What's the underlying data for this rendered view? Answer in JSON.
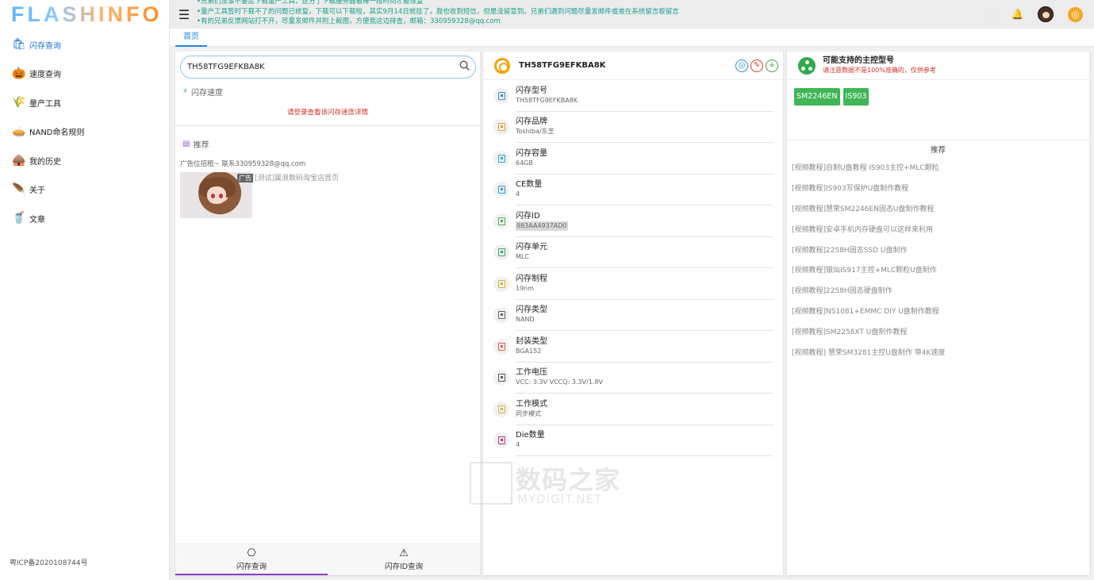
{
  "app": {
    "logo": "FLASHINFO",
    "icp": "粤ICP备2020108744号"
  },
  "header": {
    "notices": [
      "•兄弟们没事不要乱下载量产工具，这分了下载服务器着棒一段时间才能恢复",
      "•量产工具暂时下载不了的问题已修复，下载可以下载啦，其实9月14日就挂了，我也收到短信，但是没留意到。兄弟们遇到问题尽量发邮件或者在系统留言板留言",
      "•有的兄弟反馈网站打不开，尽量发邮件并附上截图，方便我这边排查，邮箱：330959328@qq.com"
    ]
  },
  "sidebar": {
    "items": [
      {
        "label": "闪存查询",
        "icon": "🛍",
        "active": true
      },
      {
        "label": "速度查询",
        "icon": "🎃"
      },
      {
        "label": "量产工具",
        "icon": "🌾"
      },
      {
        "label": "NAND命名规则",
        "icon": "🥧"
      },
      {
        "label": "我的历史",
        "icon": "🛖"
      },
      {
        "label": "关于",
        "icon": "🪶"
      },
      {
        "label": "文章",
        "icon": "🥤"
      }
    ]
  },
  "tabs": {
    "home": "首页"
  },
  "left": {
    "search_value": "TH58TFG9EFKBA8K",
    "speed_title": "闪存速度",
    "speed_msg": "请登录查看该闪存速度详情",
    "rec_title": "推荐",
    "ad_text": "广告位招租~ 联系330959328@qq.com",
    "ad_badge": "广告",
    "ad_label": "[测试]翼浪数码淘宝店首页",
    "bottom_tabs": [
      {
        "label": "闪存查询",
        "icon": "chip-icon"
      },
      {
        "label": "闪存ID查询",
        "icon": "warning-icon"
      }
    ]
  },
  "detail": {
    "title": "TH58TFG9EFKBA8K",
    "fields": [
      {
        "label": "闪存型号",
        "value": "TH58TFG9EFKBA8K",
        "color": "#3a8fd0"
      },
      {
        "label": "闪存品牌",
        "value": "Toshiba/东芝",
        "color": "#e2a23a"
      },
      {
        "label": "闪存容量",
        "value": "64GB",
        "color": "#2fa3c9"
      },
      {
        "label": "CE数量",
        "value": "4",
        "color": "#2f9ad6"
      },
      {
        "label": "闪存ID",
        "value": "983AA4937AD0",
        "color": "#4caf50"
      },
      {
        "label": "闪存单元",
        "value": "MLC",
        "color": "#3aa071"
      },
      {
        "label": "闪存制程",
        "value": "19nm",
        "color": "#c9b93a"
      },
      {
        "label": "闪存类型",
        "value": "NAND",
        "color": "#666666"
      },
      {
        "label": "封装类型",
        "value": "BGA152",
        "color": "#e0603a"
      },
      {
        "label": "工作电压",
        "value": "VCC: 3.3V VCCQ: 3.3V/1.8V",
        "color": "#555555"
      },
      {
        "label": "工作模式",
        "value": "同步模式",
        "color": "#e2b23a"
      },
      {
        "label": "Die数量",
        "value": "4",
        "color": "#c0357f"
      }
    ]
  },
  "controllers": {
    "title": "可能支持的主控型号",
    "subtitle": "请注意数据不是100%准确的，仅供参考",
    "tags": [
      "SM2246EN",
      "IS903"
    ],
    "rec_title": "推荐",
    "recommendations": [
      "[视频教程]自制U盘教程 IS903主控+MLC颗粒",
      "[视频教程]IS903写保护U盘制作教程",
      "[视频教程]慧荣SM2246EN固态U盘制作教程",
      "[视频教程]安卓手机内存硬盘可以这样来利用",
      "[视频教程]2258H固态SSD U盘制作",
      "[视频教程]银灿IS917主控+MLC颗粒U盘制作",
      "[视频教程]2258H固态硬盘制作",
      "[视频教程]NS1081+EMMC DIY U盘制作教程",
      "[视频教程]SM2258XT U盘制作教程",
      "[视频教程] 慧荣SM3281主控U盘制作 带4K速度"
    ]
  },
  "watermark": {
    "cn": "数码之家",
    "en": "MYDIGIT.NET"
  }
}
